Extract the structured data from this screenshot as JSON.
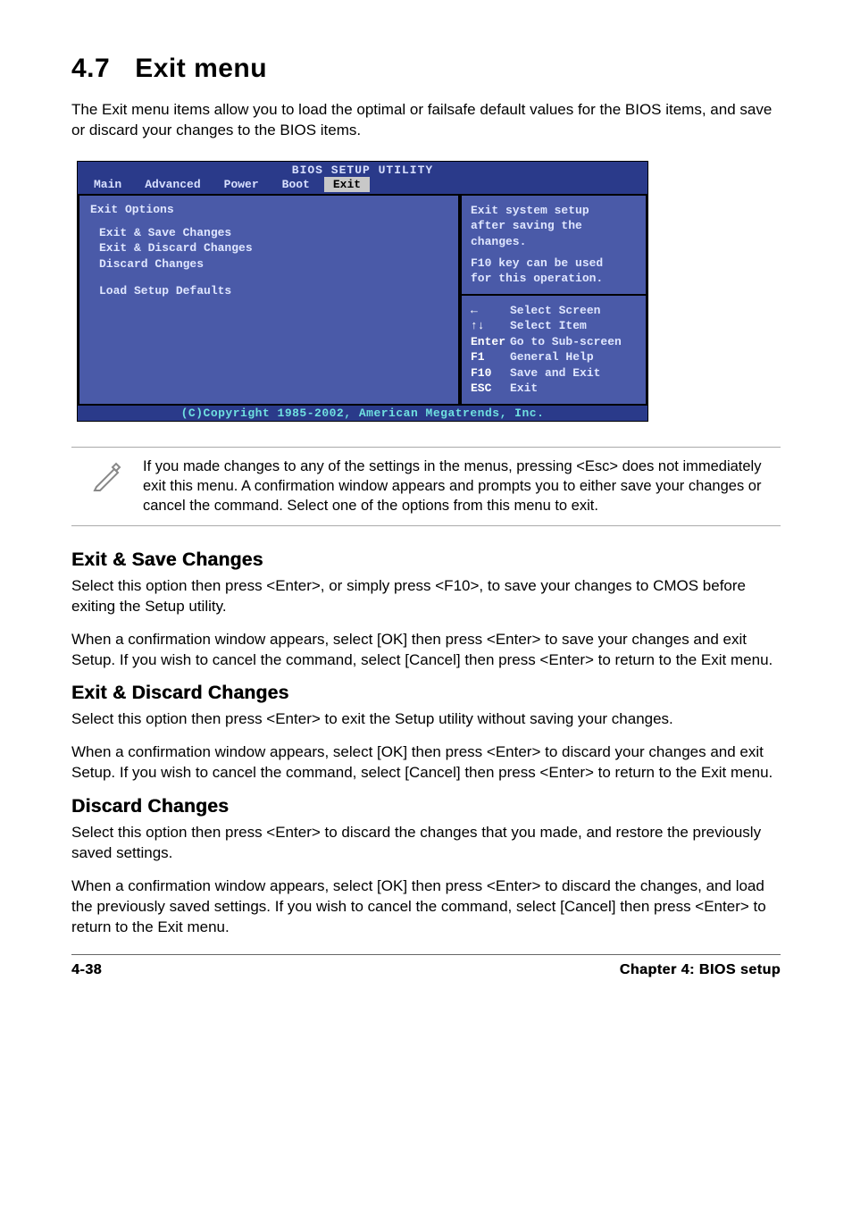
{
  "page": {
    "heading_num": "4.7",
    "heading_text": "Exit menu",
    "intro": "The Exit menu items allow you to load the optimal or failsafe default values for the BIOS items, and save or discard your changes to the BIOS items."
  },
  "bios": {
    "title": "BIOS SETUP UTILITY",
    "tabs": [
      "Main",
      "Advanced",
      "Power",
      "Boot",
      "Exit"
    ],
    "active_tab": "Exit",
    "left": {
      "section_title": "Exit Options",
      "items": [
        "Exit & Save Changes",
        "Exit & Discard Changes",
        "Discard Changes"
      ],
      "item_after_gap": "Load Setup Defaults"
    },
    "help": {
      "line1": "Exit system setup",
      "line2": "after saving the",
      "line3": "changes.",
      "line4": "F10 key can be used",
      "line5": "for this operation."
    },
    "nav": [
      {
        "key": "←",
        "label": "Select Screen"
      },
      {
        "key": "↑↓",
        "label": "Select Item"
      },
      {
        "key": "Enter",
        "label": "Go to Sub-screen"
      },
      {
        "key": "F1",
        "label": "General Help"
      },
      {
        "key": "F10",
        "label": "Save and Exit"
      },
      {
        "key": "ESC",
        "label": "Exit"
      }
    ],
    "copyright": "(C)Copyright 1985-2002, American Megatrends, Inc."
  },
  "note": "If you made changes to any of the settings in the menus, pressing <Esc> does not immediately exit this menu. A confirmation window appears and prompts you to either save your changes or cancel the command. Select one of the options from this menu to exit.",
  "sections": {
    "s1": {
      "title": "Exit & Save Changes",
      "p1": "Select this option then press <Enter>, or simply press <F10>, to save your changes to CMOS before exiting the Setup utility.",
      "p2": "When a confirmation window appears, select [OK] then press <Enter> to save your changes and exit Setup. If you wish to cancel the command, select [Cancel] then press <Enter> to return to the Exit menu."
    },
    "s2": {
      "title": "Exit & Discard Changes",
      "p1": "Select this option then press <Enter> to exit the Setup utility without saving your changes.",
      "p2": "When a confirmation window appears, select [OK] then press <Enter> to discard your changes and exit Setup. If you wish to cancel the command, select [Cancel] then press <Enter> to return to the Exit menu."
    },
    "s3": {
      "title": "Discard Changes",
      "p1": "Select this option then press <Enter> to discard the changes that you made, and restore the previously saved settings.",
      "p2": "When a confirmation window appears, select [OK] then press <Enter> to discard the changes, and load the previously saved settings. If you wish to cancel the command, select [Cancel] then press <Enter> to return to the Exit menu."
    }
  },
  "footer": {
    "left": "4-38",
    "right": "Chapter 4: BIOS setup"
  }
}
